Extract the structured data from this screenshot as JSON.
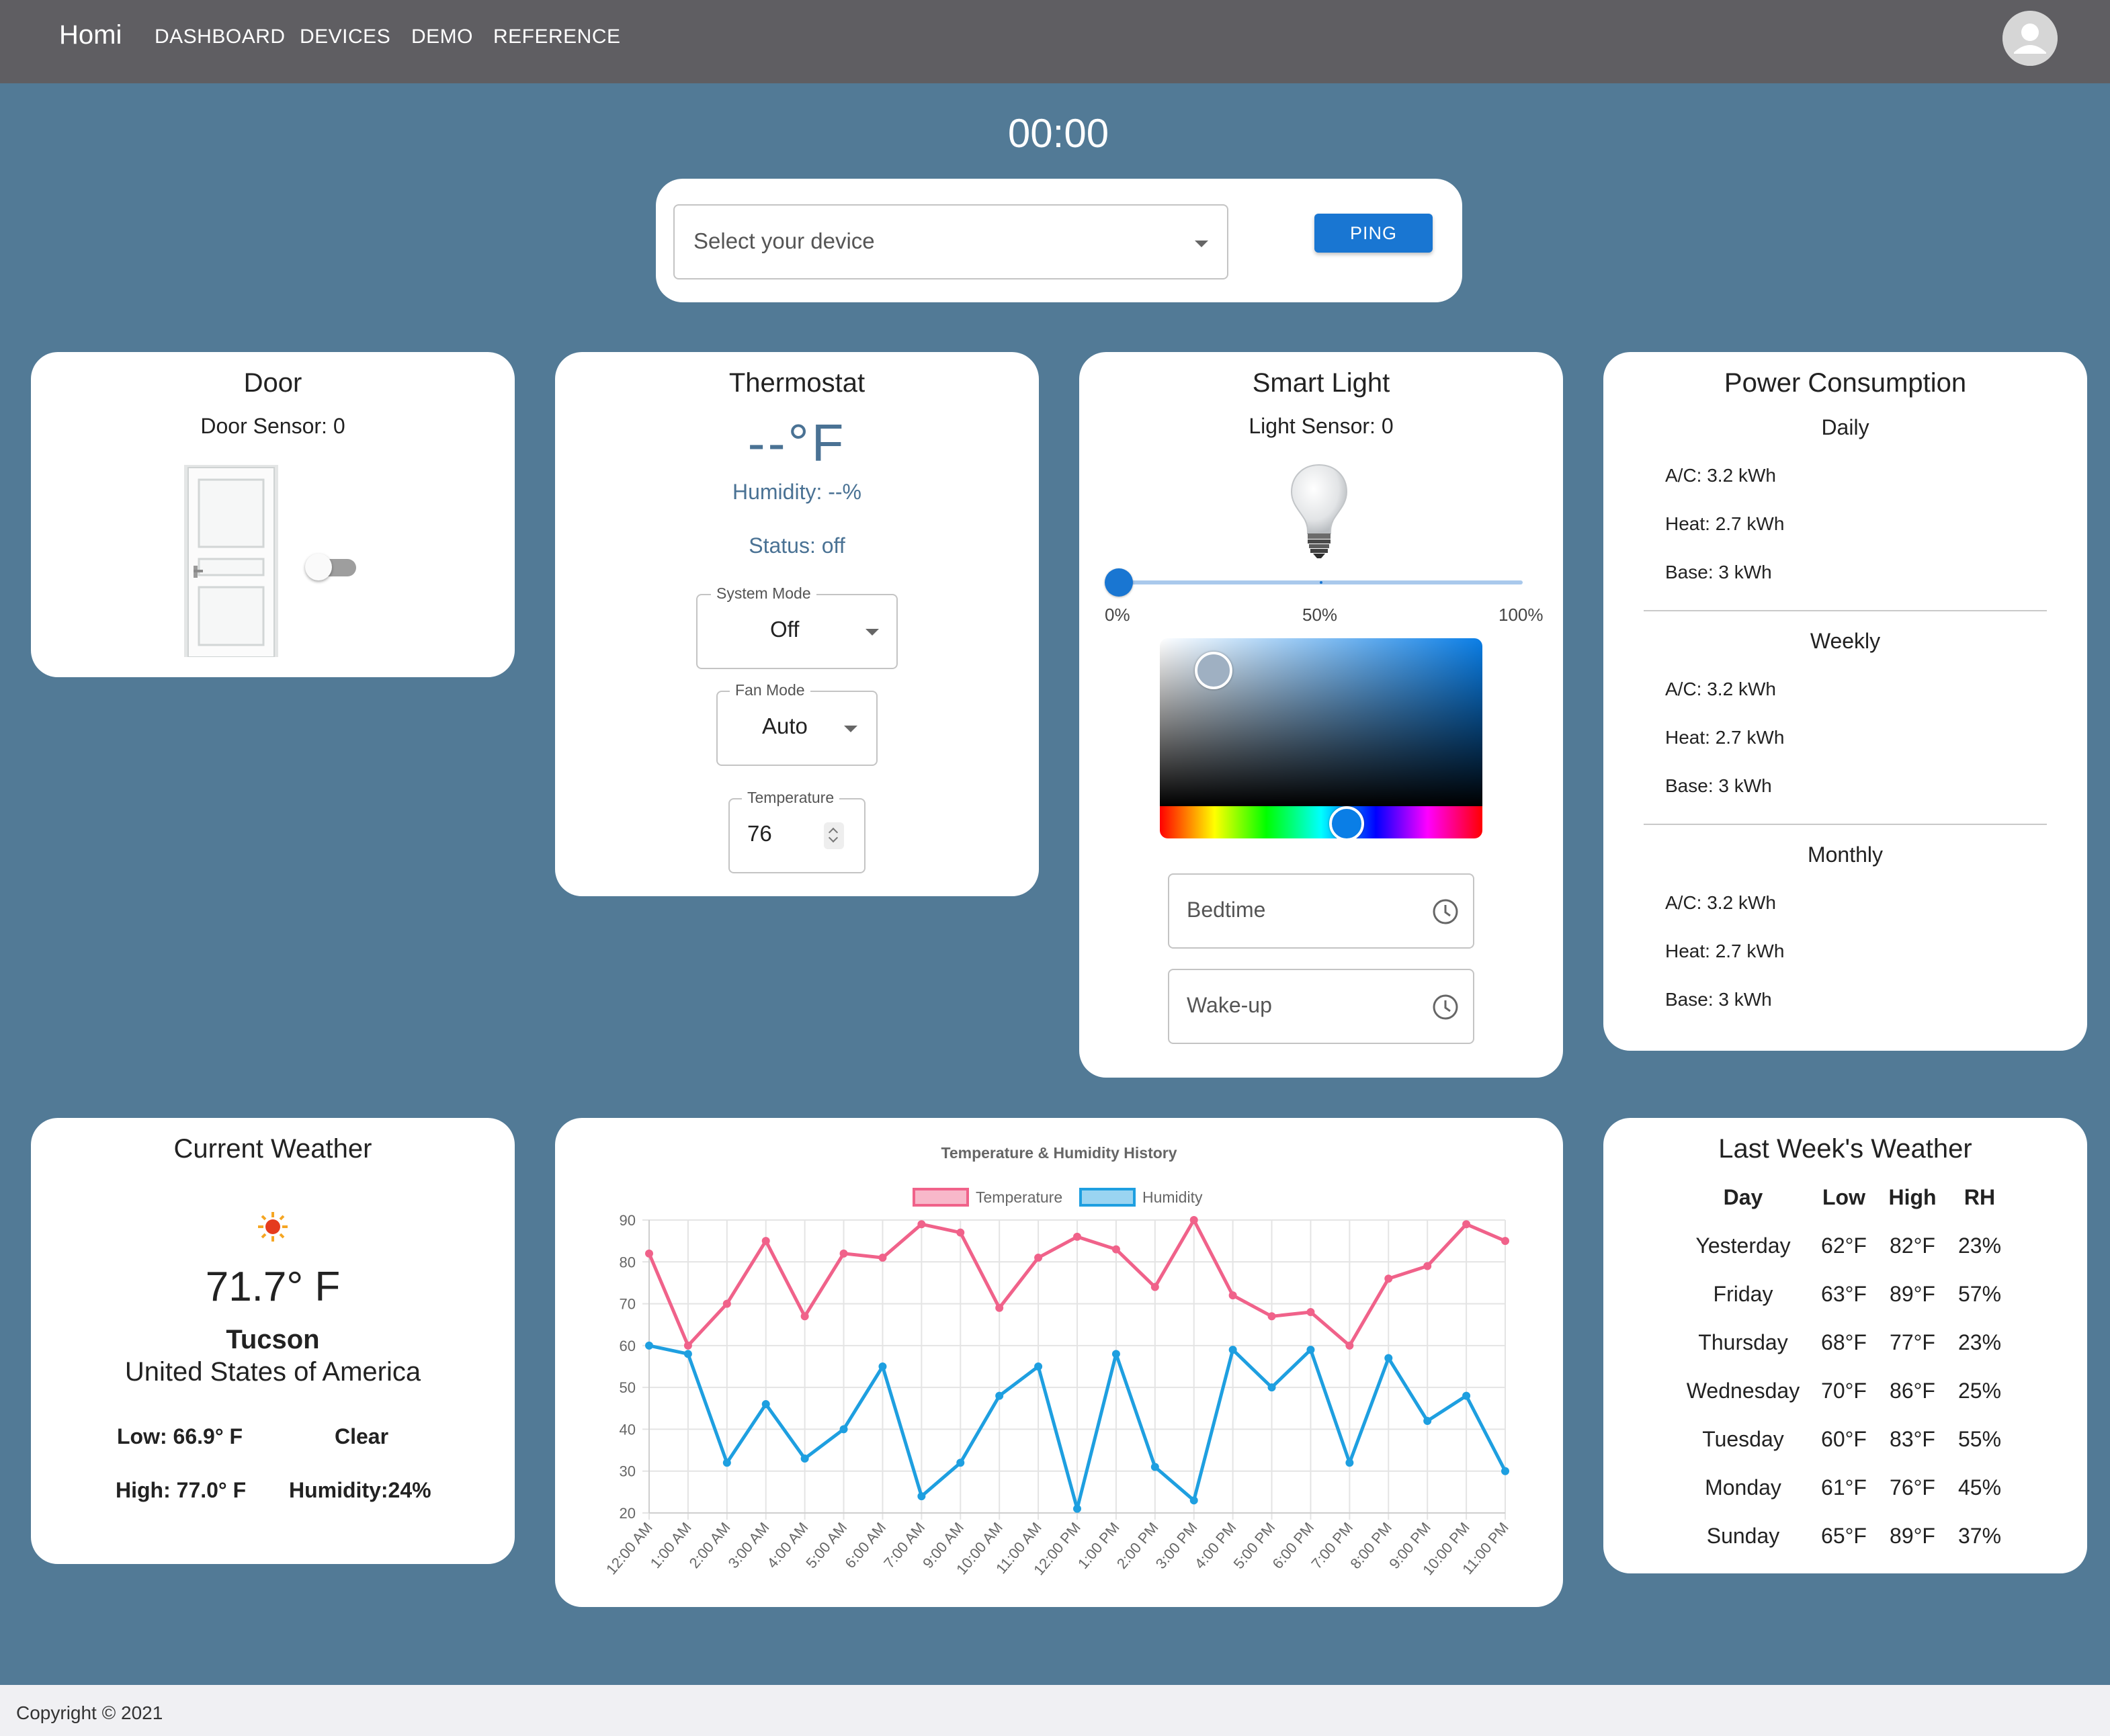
{
  "navbar": {
    "brand": "Homi",
    "links": [
      "DASHBOARD",
      "DEVICES",
      "DEMO",
      "REFERENCE"
    ]
  },
  "clock": "00:00",
  "ping_panel": {
    "device_placeholder": "Select your device",
    "ping_label": "PING"
  },
  "door": {
    "title": "Door",
    "sensor": "Door Sensor: 0",
    "toggle_on": false
  },
  "thermostat": {
    "title": "Thermostat",
    "temperature": "--°F",
    "humidity": "Humidity: --%",
    "status": "Status: off",
    "system_mode": {
      "label": "System Mode",
      "value": "Off"
    },
    "fan_mode": {
      "label": "Fan Mode",
      "value": "Auto"
    },
    "temperature_field": {
      "label": "Temperature",
      "value": "76"
    }
  },
  "smart_light": {
    "title": "Smart Light",
    "sensor": "Light Sensor: 0",
    "brightness_percent": 0,
    "slider_marks": [
      "0%",
      "50%",
      "100%"
    ],
    "bedtime_placeholder": "Bedtime",
    "wakeup_placeholder": "Wake-up"
  },
  "power": {
    "title": "Power Consumption",
    "sections": [
      {
        "name": "Daily",
        "items": [
          "A/C: 3.2 kWh",
          "Heat: 2.7 kWh",
          "Base: 3 kWh"
        ]
      },
      {
        "name": "Weekly",
        "items": [
          "A/C: 3.2 kWh",
          "Heat: 2.7 kWh",
          "Base: 3 kWh"
        ]
      },
      {
        "name": "Monthly",
        "items": [
          "A/C: 3.2 kWh",
          "Heat: 2.7 kWh",
          "Base: 3 kWh"
        ]
      }
    ]
  },
  "current_weather": {
    "title": "Current Weather",
    "icon": "sun-icon",
    "temperature": "71.7° F",
    "city": "Tucson",
    "country": "United States of America",
    "low": "Low: 66.9° F",
    "condition": "Clear",
    "high": "High: 77.0° F",
    "humidity": "Humidity:24%"
  },
  "chart_data": {
    "type": "line",
    "title": "Temperature & Humidity History",
    "x": [
      "12:00 AM",
      "1:00 AM",
      "2:00 AM",
      "3:00 AM",
      "4:00 AM",
      "5:00 AM",
      "6:00 AM",
      "7:00 AM",
      "9:00 AM",
      "10:00 AM",
      "11:00 AM",
      "12:00 PM",
      "1:00 PM",
      "2:00 PM",
      "3:00 PM",
      "4:00 PM",
      "5:00 PM",
      "6:00 PM",
      "7:00 PM",
      "8:00 PM",
      "9:00 PM",
      "10:00 PM",
      "11:00 PM"
    ],
    "series": [
      {
        "name": "Temperature",
        "color": "#f0628a",
        "values": [
          82,
          60,
          70,
          85,
          67,
          82,
          81,
          89,
          87,
          69,
          81,
          86,
          83,
          74,
          90,
          72,
          67,
          68,
          60,
          76,
          79,
          89,
          85
        ]
      },
      {
        "name": "Humidity",
        "color": "#1e9fe0",
        "values": [
          60,
          58,
          32,
          46,
          33,
          40,
          55,
          24,
          32,
          48,
          55,
          21,
          58,
          31,
          23,
          59,
          50,
          59,
          32,
          57,
          42,
          48,
          30
        ]
      }
    ],
    "ylim": [
      20,
      90
    ],
    "yticks": [
      20,
      30,
      40,
      50,
      60,
      70,
      80,
      90
    ],
    "grid": true,
    "legend": "top"
  },
  "last_week": {
    "title": "Last Week's Weather",
    "headers": [
      "Day",
      "Low",
      "High",
      "RH"
    ],
    "rows": [
      [
        "Yesterday",
        "62°F",
        "82°F",
        "23%"
      ],
      [
        "Friday",
        "63°F",
        "89°F",
        "57%"
      ],
      [
        "Thursday",
        "68°F",
        "77°F",
        "23%"
      ],
      [
        "Wednesday",
        "70°F",
        "86°F",
        "25%"
      ],
      [
        "Tuesday",
        "60°F",
        "83°F",
        "55%"
      ],
      [
        "Monday",
        "61°F",
        "76°F",
        "45%"
      ],
      [
        "Sunday",
        "65°F",
        "89°F",
        "37%"
      ]
    ]
  },
  "footer": "Copyright © 2021"
}
